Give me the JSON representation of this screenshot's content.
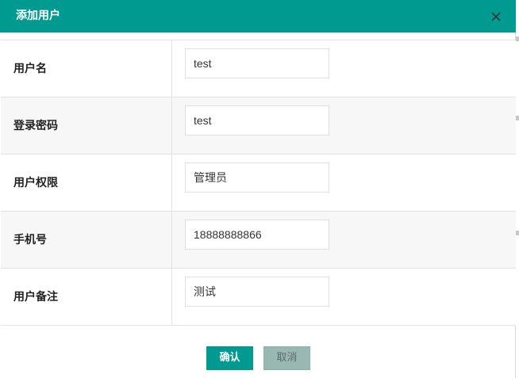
{
  "dialog": {
    "title": "添加用户",
    "close_icon": "close-icon",
    "accent_color": "#009a91"
  },
  "form": {
    "rows": [
      {
        "label": "用户名",
        "value": "test"
      },
      {
        "label": "登录密码",
        "value": "test"
      },
      {
        "label": "用户权限",
        "value": "管理员"
      },
      {
        "label": "手机号",
        "value": "18888888866"
      },
      {
        "label": "用户备注",
        "value": "测试"
      }
    ]
  },
  "footer": {
    "confirm_label": "确认",
    "cancel_label": "取消"
  }
}
